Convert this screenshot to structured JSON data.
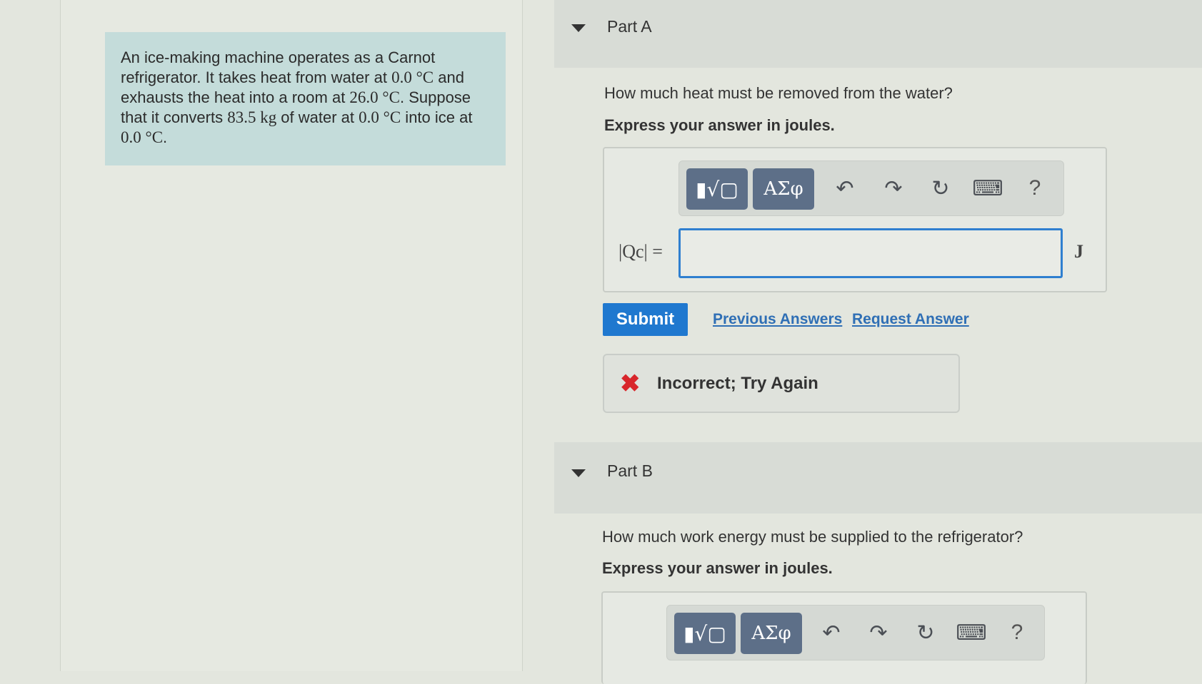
{
  "problem": {
    "parts": [
      "An ice-making machine operates as a Carnot refrigerator. It takes heat from water at ",
      "0.0 °C",
      " and exhausts the heat into a room at ",
      "26.0 °C",
      ". Suppose that it converts ",
      "83.5 kg",
      " of water at ",
      "0.0 °C",
      " into ice at ",
      "0.0 °C",
      "."
    ]
  },
  "partA": {
    "title": "Part A",
    "question": "How much heat must be removed from the water?",
    "instruction": "Express your answer in joules.",
    "toolbar": {
      "templates_label": "▮√▢",
      "symbols_label": "ΑΣφ",
      "undo_icon": "↶",
      "redo_icon": "↷",
      "reset_icon": "↻",
      "keyboard_icon": "⌨",
      "help_label": "?"
    },
    "eq_label": "|Qc| =",
    "input_value": "",
    "unit": "J",
    "submit_label": "Submit",
    "previous_answers": "Previous Answers",
    "request_answer": "Request Answer",
    "feedback_icon": "✖",
    "feedback_text": "Incorrect; Try Again"
  },
  "partB": {
    "title": "Part B",
    "question": "How much work energy must be supplied to the refrigerator?",
    "instruction": "Express your answer in joules.",
    "toolbar": {
      "templates_label": "▮√▢",
      "symbols_label": "ΑΣφ",
      "undo_icon": "↶",
      "redo_icon": "↷",
      "reset_icon": "↻",
      "keyboard_icon": "⌨",
      "help_label": "?"
    }
  },
  "colors": {
    "accent": "#1f78cf",
    "error": "#d8262b",
    "problem_bg": "#c4dcda"
  }
}
